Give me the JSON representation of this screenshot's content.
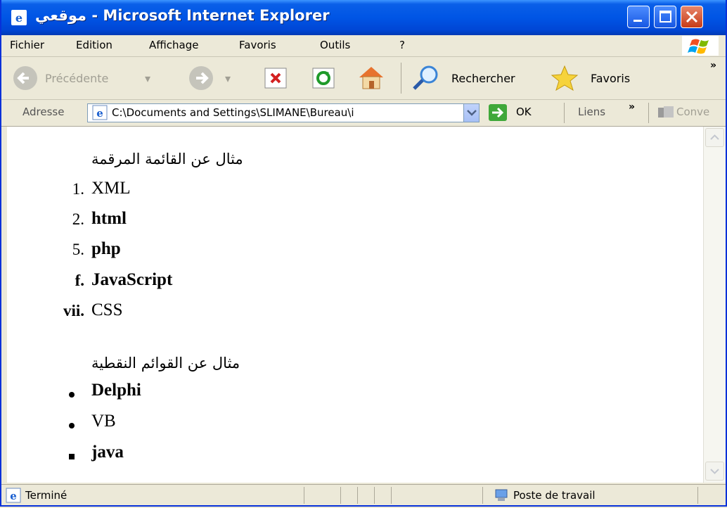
{
  "window": {
    "title": "موقعي - Microsoft Internet Explorer"
  },
  "menu": [
    "Fichier",
    "Edition",
    "Affichage",
    "Favoris",
    "Outils",
    "?"
  ],
  "toolbar": {
    "back_label": "Précédente",
    "search_label": "Rechercher",
    "favorites_label": "Favoris",
    "overflow": "»"
  },
  "address": {
    "label": "Adresse",
    "value": "C:\\Documents and Settings\\SLIMANE\\Bureau\\i",
    "go_label": "OK",
    "links_label": "Liens",
    "links_overflow": "»",
    "convert_label": "Conve"
  },
  "page": {
    "ordered_heading": "مثال عن القائمة المرقمة",
    "ordered_items": [
      {
        "marker": "1.",
        "text": "XML"
      },
      {
        "marker": "2.",
        "text": "html"
      },
      {
        "marker": "5.",
        "text": "php"
      },
      {
        "marker": "f.",
        "text": "JavaScript"
      },
      {
        "marker": "vii.",
        "text": "CSS"
      }
    ],
    "unordered_heading": "مثال عن القوائم النقطية",
    "unordered_items": [
      {
        "bullet": "disc",
        "text": "Delphi"
      },
      {
        "bullet": "disc",
        "text": "VB"
      },
      {
        "bullet": "square",
        "text": "java"
      }
    ]
  },
  "status": {
    "left_text": "Terminé",
    "zone_text": "Poste de travail"
  },
  "colors": {
    "titlebar": "#0055e5",
    "close_button": "#c63b17",
    "chrome": "#ece9d8"
  }
}
